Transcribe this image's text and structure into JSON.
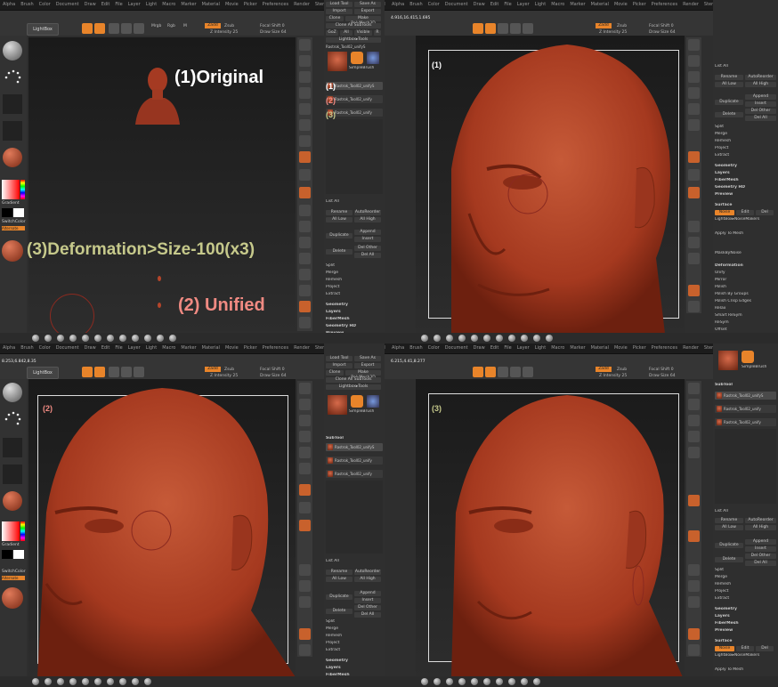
{
  "menu": [
    "Alpha",
    "Brush",
    "Color",
    "Document",
    "Draw",
    "Edit",
    "File",
    "Layer",
    "Light",
    "Macro",
    "Marker",
    "Material",
    "Movie",
    "Picker",
    "Preferences",
    "Render",
    "Stencil",
    "Stroke",
    "Texture",
    "Tool",
    "Transform",
    "Zplugin",
    "Zscript"
  ],
  "toolbar": {
    "lightbox": "LightBox",
    "mrgb": "Mrgb",
    "rgb": "Rgb",
    "m": "M",
    "zadd": "Zadd",
    "zsub": "Zsub",
    "focal_shift": "Focal Shift 0",
    "z_intensity": "Z Intensity 25",
    "draw_size": "Draw Size 64",
    "rgb_intensity": "Rgb Intensity",
    "q3_coords": "8.253,6.842,8.35",
    "q2_coords": "4.916,16.415,1.695",
    "q4_coords": "6.215,4.41,8.277"
  },
  "annotations": {
    "original": "(1)Original",
    "deformation": "(3)Deformation>Size-100(x3)",
    "unified": "(2) Unified",
    "label1": "(1)",
    "label2": "(2)",
    "label3": "(3)"
  },
  "tool_panel": {
    "load_tool": "Load Tool",
    "save_as": "Save As",
    "import": "Import",
    "export": "Export",
    "clone": "Clone",
    "make_polymesh": "Make PolyMesh3D",
    "clone_all_subtools": "Clone All SubTools",
    "goz": "GoZ",
    "all": "All",
    "visible": "Visible",
    "r": "R",
    "lightbox_tools": "Lightbox▸Tools",
    "tool_name": "Rastrok_Tool02_unifyS",
    "simple_brush": "SimpleBrush",
    "subtool_header": "SubTool",
    "subtools": [
      "Rastrok_Tool02_unifyS",
      "Rastrok_Tool02_unify",
      "Rastrok_Tool02_unify"
    ],
    "list_all": "List All",
    "rename": "Rename",
    "auto_reorder": "AutoReorder",
    "all_low": "All Low",
    "all_high": "All High",
    "duplicate": "Duplicate",
    "append": "Append",
    "insert": "Insert",
    "delete": "Delete",
    "del_other": "Del Other",
    "del_all": "Del All",
    "split": "Split",
    "merge": "Merge",
    "remesh": "Remesh",
    "project": "Project",
    "extract": "Extract",
    "geometry": "Geometry",
    "layers": "Layers",
    "fibermesh": "FiberMesh",
    "geometry_hd": "Geometry HD",
    "preview": "Preview",
    "surface": "Surface",
    "noise": "Noise",
    "edit": "Edit",
    "del": "Del",
    "lightbox_noise": "LightBox▸NoiseMakers",
    "mask_by_noise": "MaskByNoise",
    "noise_by_color": "DemaskByNoise",
    "apply_to_mesh": "Apply To Mesh",
    "deformation": "Deformation",
    "unify": "Unify",
    "mirror": "Mirror",
    "polish": "Polish",
    "polish_by_groups": "Polish By Groups",
    "polish_crisp_edges": "Polish Crisp Edges",
    "relax": "Relax",
    "smart_resym": "Smart ReSym",
    "resym": "ReSym",
    "offset": "Offset",
    "rotate": "Rotate",
    "size": "Size"
  },
  "right_shelf": [
    "Bpr",
    "Spix",
    "Scroll",
    "Zoom",
    "Actual",
    "AAHalf",
    "Persp",
    "Floor",
    "Local",
    "Xyz",
    "Frame",
    "Move",
    "Scale",
    "Rotate",
    "Line Fill",
    "Transp",
    "Ghost",
    "Solo",
    "Xpose"
  ],
  "left_panel": {
    "gradient": "Gradient",
    "switch_color": "SwitchColor",
    "alternate": "Alternate"
  },
  "colors": {
    "accent": "#e8842a",
    "skin": "#b5452a",
    "annotation_white": "#ffffff",
    "annotation_red": "#f08a82",
    "annotation_olive": "#c6c98b"
  }
}
